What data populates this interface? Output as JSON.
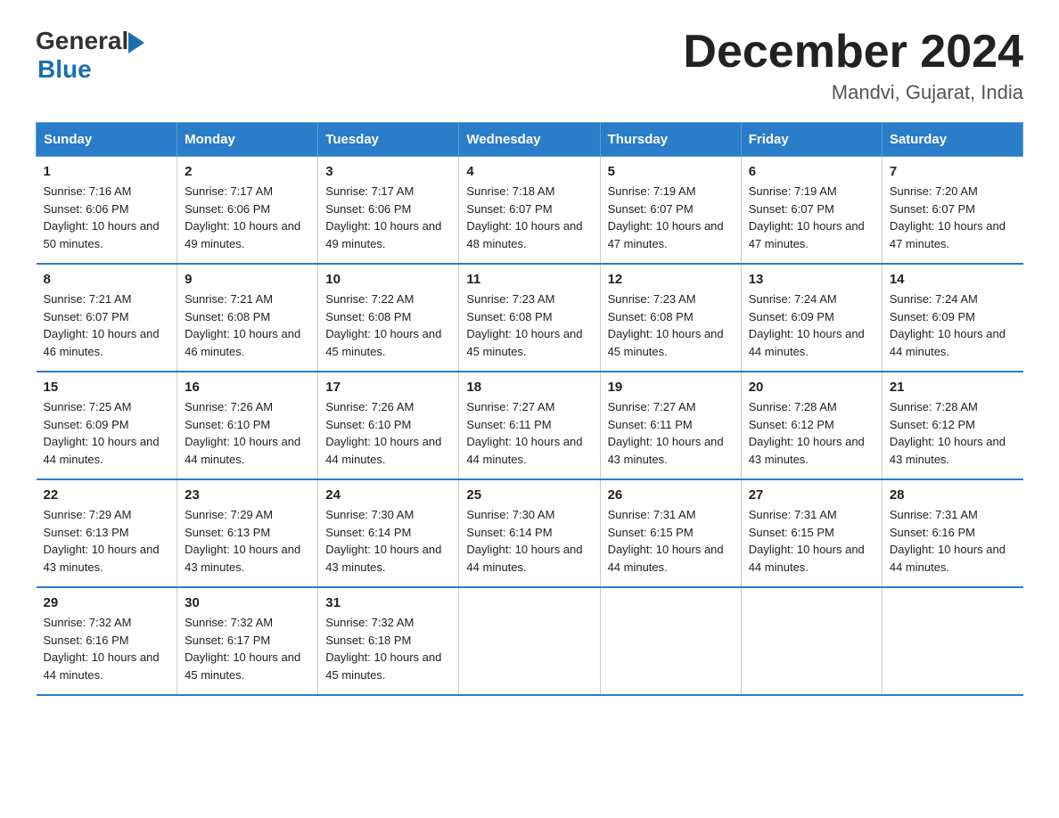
{
  "logo": {
    "text_general": "General",
    "text_blue": "Blue"
  },
  "header": {
    "title": "December 2024",
    "subtitle": "Mandvi, Gujarat, India"
  },
  "days_header": [
    "Sunday",
    "Monday",
    "Tuesday",
    "Wednesday",
    "Thursday",
    "Friday",
    "Saturday"
  ],
  "weeks": [
    [
      {
        "num": "1",
        "sunrise": "7:16 AM",
        "sunset": "6:06 PM",
        "daylight": "10 hours and 50 minutes."
      },
      {
        "num": "2",
        "sunrise": "7:17 AM",
        "sunset": "6:06 PM",
        "daylight": "10 hours and 49 minutes."
      },
      {
        "num": "3",
        "sunrise": "7:17 AM",
        "sunset": "6:06 PM",
        "daylight": "10 hours and 49 minutes."
      },
      {
        "num": "4",
        "sunrise": "7:18 AM",
        "sunset": "6:07 PM",
        "daylight": "10 hours and 48 minutes."
      },
      {
        "num": "5",
        "sunrise": "7:19 AM",
        "sunset": "6:07 PM",
        "daylight": "10 hours and 47 minutes."
      },
      {
        "num": "6",
        "sunrise": "7:19 AM",
        "sunset": "6:07 PM",
        "daylight": "10 hours and 47 minutes."
      },
      {
        "num": "7",
        "sunrise": "7:20 AM",
        "sunset": "6:07 PM",
        "daylight": "10 hours and 47 minutes."
      }
    ],
    [
      {
        "num": "8",
        "sunrise": "7:21 AM",
        "sunset": "6:07 PM",
        "daylight": "10 hours and 46 minutes."
      },
      {
        "num": "9",
        "sunrise": "7:21 AM",
        "sunset": "6:08 PM",
        "daylight": "10 hours and 46 minutes."
      },
      {
        "num": "10",
        "sunrise": "7:22 AM",
        "sunset": "6:08 PM",
        "daylight": "10 hours and 45 minutes."
      },
      {
        "num": "11",
        "sunrise": "7:23 AM",
        "sunset": "6:08 PM",
        "daylight": "10 hours and 45 minutes."
      },
      {
        "num": "12",
        "sunrise": "7:23 AM",
        "sunset": "6:08 PM",
        "daylight": "10 hours and 45 minutes."
      },
      {
        "num": "13",
        "sunrise": "7:24 AM",
        "sunset": "6:09 PM",
        "daylight": "10 hours and 44 minutes."
      },
      {
        "num": "14",
        "sunrise": "7:24 AM",
        "sunset": "6:09 PM",
        "daylight": "10 hours and 44 minutes."
      }
    ],
    [
      {
        "num": "15",
        "sunrise": "7:25 AM",
        "sunset": "6:09 PM",
        "daylight": "10 hours and 44 minutes."
      },
      {
        "num": "16",
        "sunrise": "7:26 AM",
        "sunset": "6:10 PM",
        "daylight": "10 hours and 44 minutes."
      },
      {
        "num": "17",
        "sunrise": "7:26 AM",
        "sunset": "6:10 PM",
        "daylight": "10 hours and 44 minutes."
      },
      {
        "num": "18",
        "sunrise": "7:27 AM",
        "sunset": "6:11 PM",
        "daylight": "10 hours and 44 minutes."
      },
      {
        "num": "19",
        "sunrise": "7:27 AM",
        "sunset": "6:11 PM",
        "daylight": "10 hours and 43 minutes."
      },
      {
        "num": "20",
        "sunrise": "7:28 AM",
        "sunset": "6:12 PM",
        "daylight": "10 hours and 43 minutes."
      },
      {
        "num": "21",
        "sunrise": "7:28 AM",
        "sunset": "6:12 PM",
        "daylight": "10 hours and 43 minutes."
      }
    ],
    [
      {
        "num": "22",
        "sunrise": "7:29 AM",
        "sunset": "6:13 PM",
        "daylight": "10 hours and 43 minutes."
      },
      {
        "num": "23",
        "sunrise": "7:29 AM",
        "sunset": "6:13 PM",
        "daylight": "10 hours and 43 minutes."
      },
      {
        "num": "24",
        "sunrise": "7:30 AM",
        "sunset": "6:14 PM",
        "daylight": "10 hours and 43 minutes."
      },
      {
        "num": "25",
        "sunrise": "7:30 AM",
        "sunset": "6:14 PM",
        "daylight": "10 hours and 44 minutes."
      },
      {
        "num": "26",
        "sunrise": "7:31 AM",
        "sunset": "6:15 PM",
        "daylight": "10 hours and 44 minutes."
      },
      {
        "num": "27",
        "sunrise": "7:31 AM",
        "sunset": "6:15 PM",
        "daylight": "10 hours and 44 minutes."
      },
      {
        "num": "28",
        "sunrise": "7:31 AM",
        "sunset": "6:16 PM",
        "daylight": "10 hours and 44 minutes."
      }
    ],
    [
      {
        "num": "29",
        "sunrise": "7:32 AM",
        "sunset": "6:16 PM",
        "daylight": "10 hours and 44 minutes."
      },
      {
        "num": "30",
        "sunrise": "7:32 AM",
        "sunset": "6:17 PM",
        "daylight": "10 hours and 45 minutes."
      },
      {
        "num": "31",
        "sunrise": "7:32 AM",
        "sunset": "6:18 PM",
        "daylight": "10 hours and 45 minutes."
      },
      null,
      null,
      null,
      null
    ]
  ]
}
